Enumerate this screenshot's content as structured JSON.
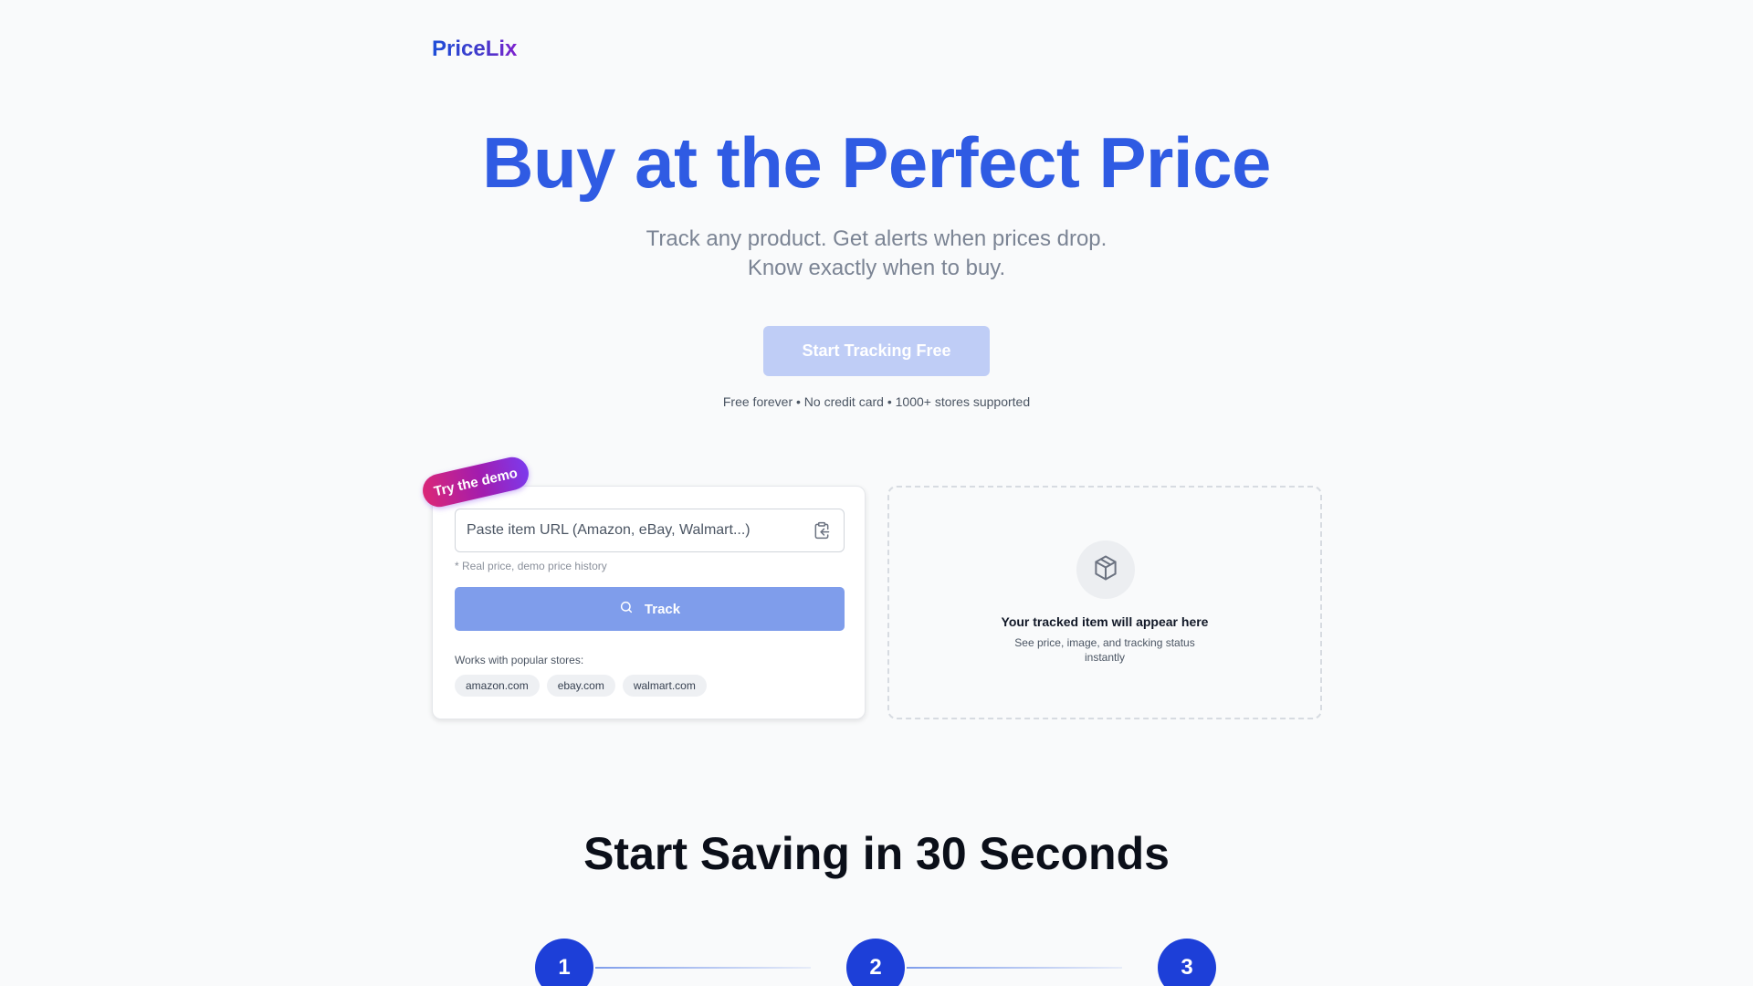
{
  "brand": {
    "name": "PriceLix"
  },
  "hero": {
    "title": "Buy at the Perfect Price",
    "subtitle_line1": "Track any product. Get alerts when prices drop.",
    "subtitle_line2": "Know exactly when to buy.",
    "cta_label": "Start Tracking Free",
    "cta_note": "Free forever • No credit card • 1000+ stores supported"
  },
  "demo": {
    "badge": "Try the demo",
    "url_placeholder": "Paste item URL (Amazon, eBay, Walmart...)",
    "url_value": "",
    "note": "* Real price, demo price history",
    "track_label": "Track",
    "stores_label": "Works with popular stores:",
    "stores": [
      "amazon.com",
      "ebay.com",
      "walmart.com"
    ]
  },
  "placeholder": {
    "icon": "package-icon",
    "title": "Your tracked item will appear here",
    "subtitle": "See price, image, and tracking status instantly"
  },
  "steps_section": {
    "title": "Start Saving in 30 Seconds",
    "steps": [
      "1",
      "2",
      "3"
    ]
  },
  "colors": {
    "primary": "#2f5be3",
    "cta_disabled": "#bfcdf6",
    "track_button": "#7f9deb",
    "step_circle": "#1d3fd8"
  }
}
